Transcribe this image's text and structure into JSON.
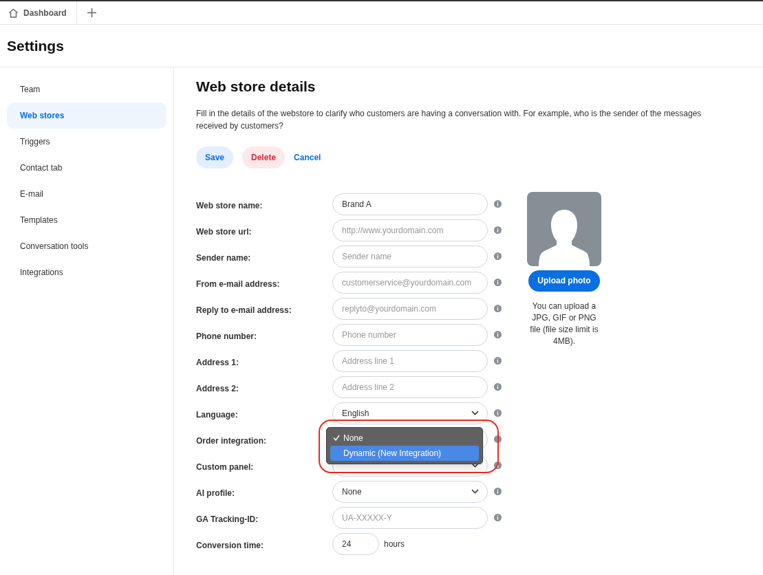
{
  "tabs": [
    {
      "label": "Dashboard",
      "selected": true
    }
  ],
  "page_title": "Settings",
  "sidebar": {
    "items": [
      {
        "label": "Team",
        "selected": false
      },
      {
        "label": "Web stores",
        "selected": true
      },
      {
        "label": "Triggers",
        "selected": false
      },
      {
        "label": "Contact tab",
        "selected": false
      },
      {
        "label": "E-mail",
        "selected": false
      },
      {
        "label": "Templates",
        "selected": false
      },
      {
        "label": "Conversation tools",
        "selected": false
      },
      {
        "label": "Integrations",
        "selected": false
      }
    ]
  },
  "section": {
    "title": "Web store details",
    "description": "Fill in the details of the webstore to clarify who customers are having a conversation with. For example, who is the sender of the messages received by customers?"
  },
  "actions": [
    {
      "label": "Save",
      "kind": "primary"
    },
    {
      "label": "Delete",
      "kind": "danger"
    },
    {
      "label": "Cancel",
      "kind": "link"
    }
  ],
  "form": [
    {
      "label": "Web store name:",
      "kind": "text",
      "value": "Brand A"
    },
    {
      "label": "Web store url:",
      "kind": "text",
      "placeholder": "http://www.yourdomain.com"
    },
    {
      "label": "Sender name:",
      "kind": "text",
      "placeholder": "Sender name"
    },
    {
      "label": "From e-mail address:",
      "kind": "text",
      "placeholder": "customerservice@yourdomain.com"
    },
    {
      "label": "Reply to e-mail address:",
      "kind": "text",
      "placeholder": "replyto@yourdomain.com"
    },
    {
      "label": "Phone number:",
      "kind": "text",
      "placeholder": "Phone number"
    },
    {
      "label": "Address 1:",
      "kind": "text",
      "placeholder": "Address line 1"
    },
    {
      "label": "Address 2:",
      "kind": "text",
      "placeholder": "Address line 2"
    },
    {
      "label": "Language:",
      "kind": "select",
      "value": "English"
    },
    {
      "label": "Order integration:",
      "kind": "select",
      "open": true,
      "options": [
        {
          "label": "None",
          "checked": true,
          "highlighted": false
        },
        {
          "label": "Dynamic (New Integration)",
          "checked": false,
          "highlighted": true
        }
      ]
    },
    {
      "label": "Custom panel:",
      "kind": "select"
    },
    {
      "label": "AI profile:",
      "kind": "select",
      "value": "None"
    },
    {
      "label": "GA Tracking-ID:",
      "kind": "text",
      "placeholder": "UA-XXXXX-Y"
    },
    {
      "label": "Conversion time:",
      "kind": "number",
      "value": "24",
      "suffix": "hours"
    }
  ],
  "photo": {
    "button": "Upload photo",
    "note": "You can upload a JPG, GIF or PNG file (file size limit is 4MB)."
  }
}
